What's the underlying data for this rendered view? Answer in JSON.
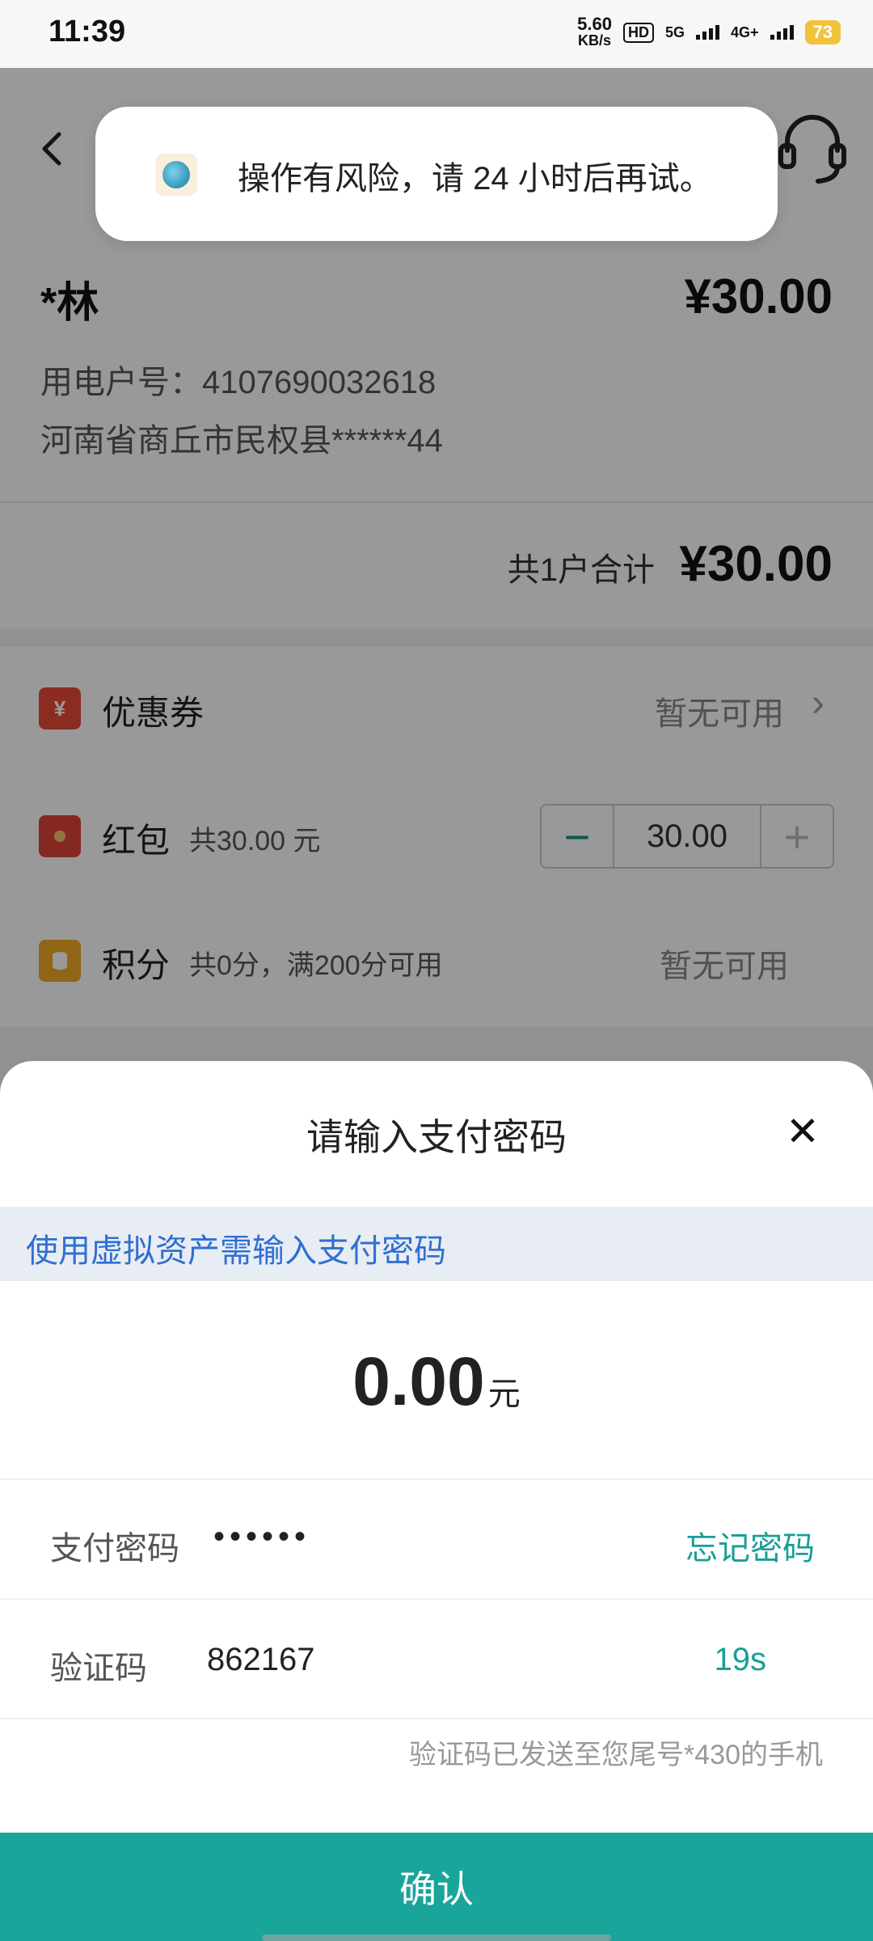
{
  "status_bar": {
    "time": "11:39",
    "speed_value": "5.60",
    "speed_unit": "KB/s",
    "hd": "HD",
    "net_5g": "5G",
    "net_4g": "4G+",
    "battery": "73"
  },
  "account": {
    "name": "*林",
    "amount": "¥30.00",
    "number_line": "用电户号：4107690032618",
    "address": "河南省商丘市民权县******44"
  },
  "total": {
    "label": "共1户合计",
    "amount": "¥30.00"
  },
  "options": {
    "coupon": {
      "icon_text": "¥",
      "title": "优惠券",
      "status": "暂无可用"
    },
    "redpacket": {
      "title": "红包",
      "subtitle": "共30.00 元",
      "value": "30.00"
    },
    "points": {
      "title": "积分",
      "subtitle": "共0分，满200分可用",
      "status": "暂无可用"
    }
  },
  "toast": {
    "message": "操作有风险，请 24 小时后再试。"
  },
  "sheet": {
    "title": "请输入支付密码",
    "notice": "使用虚拟资产需输入支付密码",
    "amount": "0.00",
    "unit": "元",
    "password_label": "支付密码",
    "password_mask": "••••••",
    "forgot": "忘记密码",
    "code_label": "验证码",
    "code_value": "862167",
    "countdown": "19s",
    "hint": "验证码已发送至您尾号*430的手机",
    "confirm": "确认"
  },
  "colors": {
    "accent": "#1aa59b",
    "link_blue": "#2f6fd1"
  }
}
